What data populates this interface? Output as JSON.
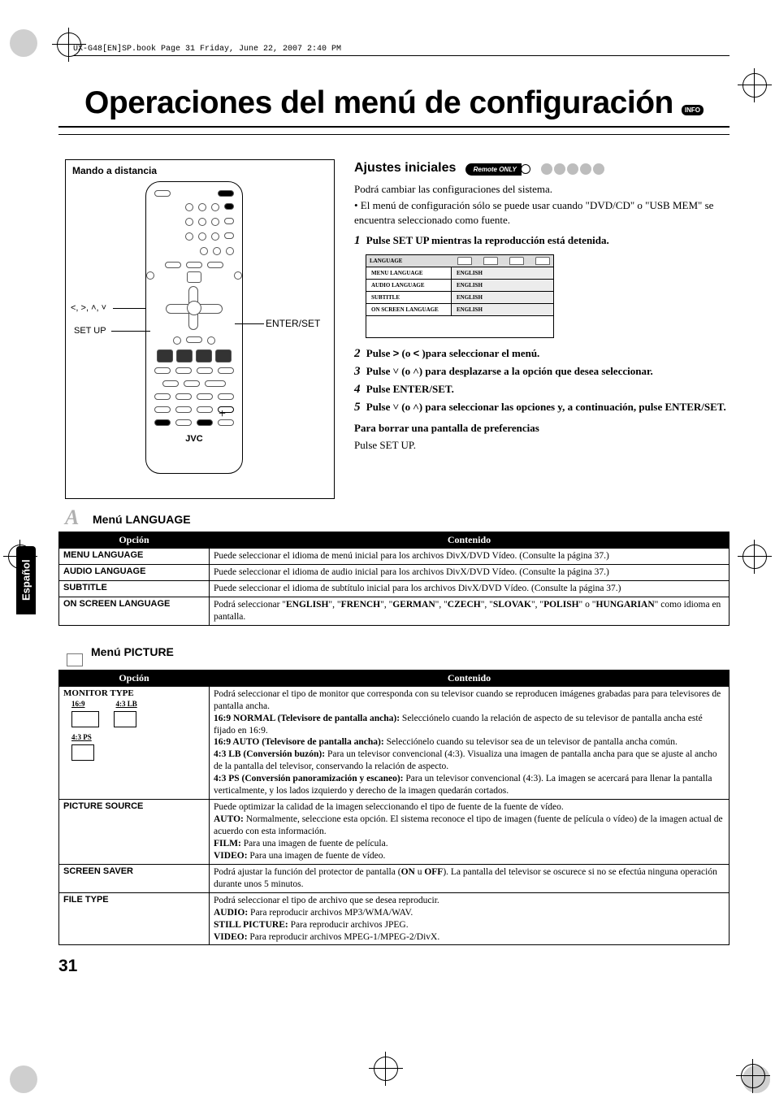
{
  "print_header": "UX-G48[EN]SP.book  Page 31  Friday, June 22, 2007  2:40 PM",
  "page_title": "Operaciones del menú de configuración",
  "info_badge": "INFO",
  "remote_box_title": "Mando a distancia",
  "labels": {
    "setup": "SET UP",
    "enter": "ENTER/SET",
    "arrows": "<, >, ˄, ˅",
    "jvc": "JVC"
  },
  "side_tab": "Español",
  "right": {
    "heading": "Ajustes iniciales",
    "remote_only": "Remote ONLY",
    "intro1": "Podrá cambiar las configuraciones del sistema.",
    "intro2": "• El menú de configuración sólo se puede usar cuando \"DVD/CD\" o \"USB MEM\" se encuentra seleccionado como fuente.",
    "steps": [
      "Pulse SET UP mientras la reproducción está detenida.",
      "Pulse > (o < )para seleccionar el menú.",
      "Pulse ˅ (o ˄) para desplazarse a la opción que desea seleccionar.",
      "Pulse ENTER/SET.",
      "Pulse ˅ (o ˄) para seleccionar las opciones y, a continuación, pulse ENTER/SET."
    ],
    "erase_title": "Para borrar una pantalla de preferencias",
    "erase_body": "Pulse SET UP.",
    "mini_menu": {
      "title": "LANGUAGE",
      "rows": [
        {
          "l": "MENU LANGUAGE",
          "r": "ENGLISH"
        },
        {
          "l": "AUDIO LANGUAGE",
          "r": "ENGLISH"
        },
        {
          "l": "SUBTITLE",
          "r": "ENGLISH"
        },
        {
          "l": "ON SCREEN LANGUAGE",
          "r": "ENGLISH"
        }
      ]
    }
  },
  "lang_menu": {
    "heading": "Menú LANGUAGE",
    "th1": "Opción",
    "th2": "Contenido",
    "rows": [
      {
        "opt": "MENU LANGUAGE",
        "content": "Puede seleccionar el idioma de menú inicial para los archivos DivX/DVD Vídeo. (Consulte la página 37.)"
      },
      {
        "opt": "AUDIO LANGUAGE",
        "content": "Puede seleccionar el idioma de audio inicial para los archivos DivX/DVD Vídeo. (Consulte la página 37.)"
      },
      {
        "opt": "SUBTITLE",
        "content": "Puede seleccionar el idioma de subtítulo inicial para los archivos DivX/DVD Vídeo. (Consulte la página 37.)"
      },
      {
        "opt": "ON SCREEN LANGUAGE",
        "content": "Podrá seleccionar \"ENGLISH\", \"FRENCH\", \"GERMAN\", \"CZECH\", \"SLOVAK\", \"POLISH\" o \"HUNGARIAN\" como idioma en pantalla."
      }
    ]
  },
  "pic_menu": {
    "heading": "Menú PICTURE",
    "th1": "Opción",
    "th2": "Contenido",
    "rows": [
      {
        "opt": "MONITOR TYPE",
        "aspects": [
          "16:9",
          "4:3 LB",
          "4:3 PS"
        ],
        "content_parts": [
          "Podrá seleccionar el tipo de monitor que corresponda con su televisor cuando se reproducen imágenes grabadas para para televisores de pantalla ancha.",
          {
            "b": "16:9 NORMAL (Televisore de pantalla ancha):",
            "t": " Selecciónelo cuando la relación de aspecto de su televisor de pantalla ancha esté fijado en 16:9."
          },
          {
            "b": "16:9 AUTO (Televisore de pantalla ancha):",
            "t": " Selecciónelo cuando su televisor sea de un televisor de pantalla ancha común."
          },
          {
            "b": "4:3 LB (Conversión buzón):",
            "t": " Para un televisor convencional (4:3). Visualiza una imagen de pantalla ancha para que se ajuste al ancho de la pantalla del televisor, conservando la relación de aspecto."
          },
          {
            "b": "4:3 PS (Conversión panoramización y escaneo):",
            "t": " Para un televisor convencional (4:3). La imagen se acercará para llenar la pantalla verticalmente, y los lados izquierdo y derecho de la imagen quedarán cortados."
          }
        ]
      },
      {
        "opt": "PICTURE SOURCE",
        "content_parts": [
          "Puede optimizar la calidad de la imagen seleccionando el tipo de fuente de la fuente de vídeo.",
          {
            "b": "AUTO:",
            "t": " Normalmente, seleccione esta opción. El sistema reconoce el tipo de imagen (fuente de película o vídeo) de la imagen actual de acuerdo con esta información."
          },
          {
            "b": "FILM:",
            "t": " Para una imagen de fuente de película."
          },
          {
            "b": "VIDEO:",
            "t": " Para una imagen de fuente de vídeo."
          }
        ]
      },
      {
        "opt": "SCREEN SAVER",
        "content_plain": "Podrá ajustar la función del protector de pantalla (ON u OFF). La pantalla del televisor se oscurece si no se efectúa ninguna operación durante unos 5 minutos."
      },
      {
        "opt": "FILE TYPE",
        "content_parts": [
          "Podrá seleccionar el tipo de archivo que se desea reproducir.",
          {
            "b": "AUDIO:",
            "t": " Para reproducir archivos MP3/WMA/WAV."
          },
          {
            "b": "STILL PICTURE:",
            "t": " Para reproducir archivos JPEG."
          },
          {
            "b": "VIDEO:",
            "t": " Para reproducir archivos MPEG-1/MPEG-2/DivX."
          }
        ]
      }
    ]
  },
  "page_number": "31"
}
